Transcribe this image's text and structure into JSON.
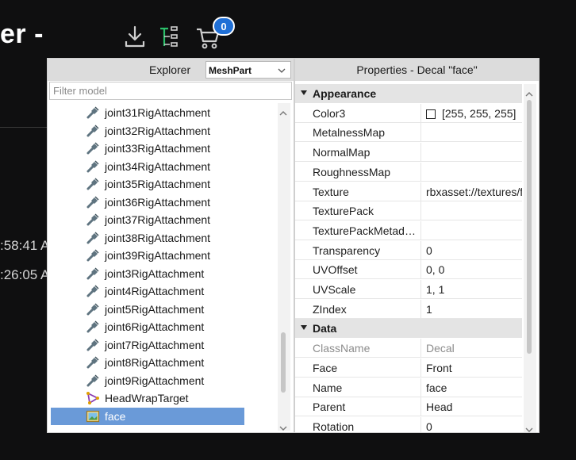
{
  "background": {
    "title": "er -",
    "times": [
      ":58:41 A",
      ":26:05 A"
    ],
    "cart_count": "0",
    "icons": [
      "download-icon",
      "hierarchy-icon",
      "cart-icon"
    ]
  },
  "explorer": {
    "title": "Explorer",
    "filter_selected": "MeshPart",
    "filter_placeholder": "Filter model",
    "items": [
      {
        "label": "joint31RigAttachment",
        "icon": "attachment-icon"
      },
      {
        "label": "joint32RigAttachment",
        "icon": "attachment-icon"
      },
      {
        "label": "joint33RigAttachment",
        "icon": "attachment-icon"
      },
      {
        "label": "joint34RigAttachment",
        "icon": "attachment-icon"
      },
      {
        "label": "joint35RigAttachment",
        "icon": "attachment-icon"
      },
      {
        "label": "joint36RigAttachment",
        "icon": "attachment-icon"
      },
      {
        "label": "joint37RigAttachment",
        "icon": "attachment-icon"
      },
      {
        "label": "joint38RigAttachment",
        "icon": "attachment-icon"
      },
      {
        "label": "joint39RigAttachment",
        "icon": "attachment-icon"
      },
      {
        "label": "joint3RigAttachment",
        "icon": "attachment-icon"
      },
      {
        "label": "joint4RigAttachment",
        "icon": "attachment-icon"
      },
      {
        "label": "joint5RigAttachment",
        "icon": "attachment-icon"
      },
      {
        "label": "joint6RigAttachment",
        "icon": "attachment-icon"
      },
      {
        "label": "joint7RigAttachment",
        "icon": "attachment-icon"
      },
      {
        "label": "joint8RigAttachment",
        "icon": "attachment-icon"
      },
      {
        "label": "joint9RigAttachment",
        "icon": "attachment-icon"
      },
      {
        "label": "HeadWrapTarget",
        "icon": "wrap-target-icon"
      },
      {
        "label": "face",
        "icon": "decal-icon",
        "selected": true
      }
    ],
    "scroll_position": 0.92
  },
  "properties": {
    "title": "Properties - Decal \"face\"",
    "categories": [
      {
        "name": "Appearance",
        "rows": [
          {
            "name": "Color3",
            "value": "[255, 255, 255]",
            "swatch": "#ffffff"
          },
          {
            "name": "MetalnessMap",
            "value": ""
          },
          {
            "name": "NormalMap",
            "value": ""
          },
          {
            "name": "RoughnessMap",
            "value": ""
          },
          {
            "name": "Texture",
            "value": "rbxasset://textures/f"
          },
          {
            "name": "TexturePack",
            "value": ""
          },
          {
            "name": "TexturePackMetad…",
            "value": ""
          },
          {
            "name": "Transparency",
            "value": "0"
          },
          {
            "name": "UVOffset",
            "value": "0, 0"
          },
          {
            "name": "UVScale",
            "value": "1, 1"
          },
          {
            "name": "ZIndex",
            "value": "1"
          }
        ]
      },
      {
        "name": "Data",
        "rows": [
          {
            "name": "ClassName",
            "value": "Decal",
            "readonly": true
          },
          {
            "name": "Face",
            "value": "Front"
          },
          {
            "name": "Name",
            "value": "face"
          },
          {
            "name": "Parent",
            "value": "Head"
          },
          {
            "name": "Rotation",
            "value": "0"
          }
        ]
      }
    ]
  },
  "colors": {
    "selection": "#6a9ad8",
    "badge": "#1f6fd6",
    "hierarchy_icon": "#2bbf6a"
  }
}
